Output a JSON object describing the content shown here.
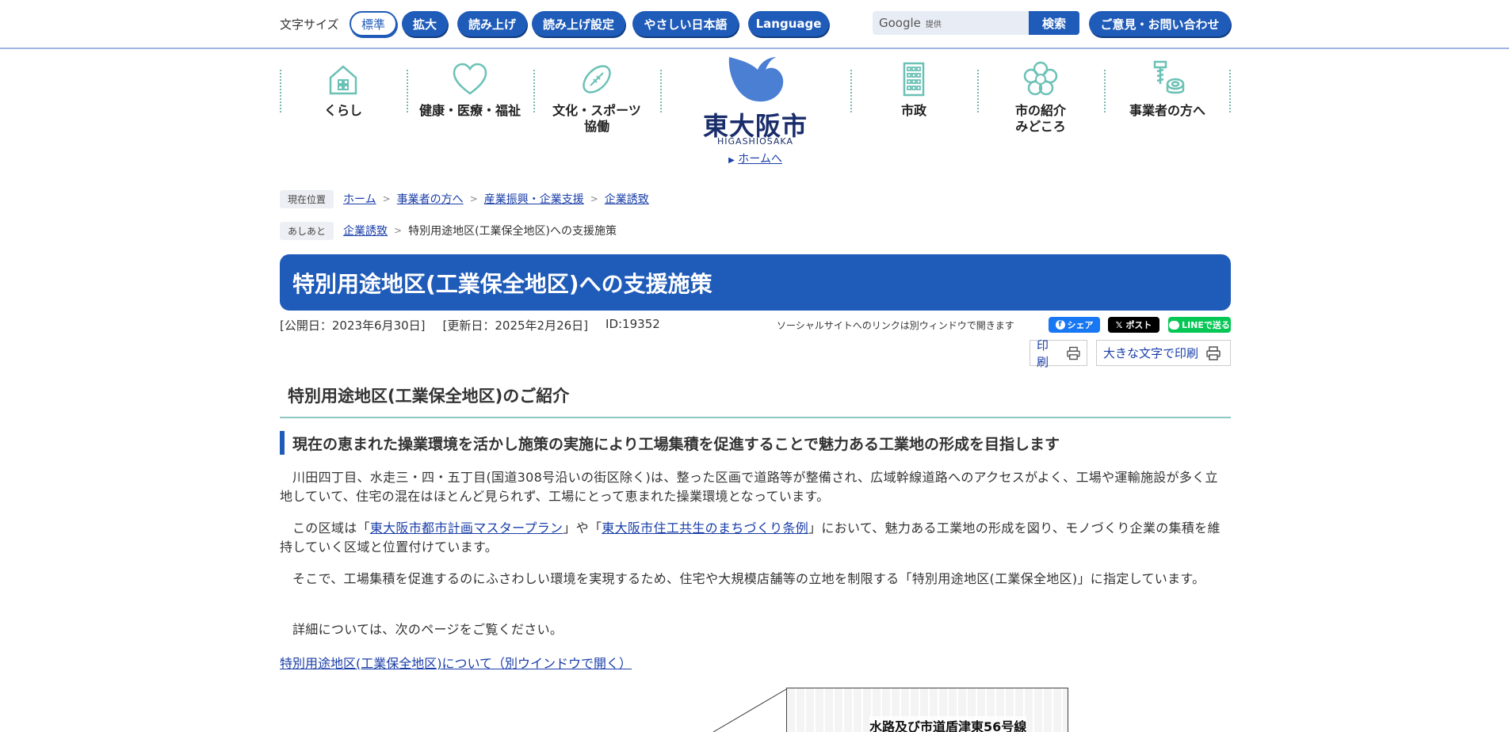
{
  "topbar": {
    "font_size_label": "文字サイズ",
    "btn_standard": "標準",
    "btn_large": "拡大",
    "btn_read": "読み上げ",
    "btn_read_settings": "読み上げ設定",
    "btn_easy_japanese": "やさしい日本語",
    "btn_language": "Language",
    "search_google": "Google",
    "search_provided": "提供",
    "search_button": "検索",
    "contact_button": "ご意見・お問い合わせ"
  },
  "nav": {
    "item_kurashi": "くらし",
    "item_health": "健康・医療・福祉",
    "item_culture_1": "文化・スポーツ",
    "item_culture_2": "協働",
    "item_shisei": "市政",
    "item_intro_1": "市の紹介",
    "item_intro_2": "みどころ",
    "item_business": "事業者の方へ"
  },
  "logo": {
    "kanji": "東大阪市",
    "roman": "HIGASHIOSAKA",
    "home_link": "ホームへ"
  },
  "breadcrumb": {
    "current_tag": "現在位置",
    "items": [
      "ホーム",
      "事業者の方へ",
      "産業振興・企業支援",
      "企業誘致"
    ],
    "history_tag": "あしあと",
    "history_link": "企業誘致",
    "history_current": "特別用途地区(工業保全地区)への支援施策"
  },
  "page": {
    "title": "特別用途地区(工業保全地区)への支援施策",
    "published": "[公開日：2023年6月30日]",
    "updated": "[更新日：2025年2月26日]",
    "id": "ID:19352",
    "social_note": "ソーシャルサイトへのリンクは別ウィンドウで開きます",
    "share_facebook": "シェア",
    "share_x": "ポスト",
    "share_line": "LINEで送る",
    "print": "印刷",
    "print_large": "大きな文字で印刷"
  },
  "content": {
    "h2": "特別用途地区(工業保全地区)のご紹介",
    "h3": "現在の恵まれた操業環境を活かし施策の実施により工場集積を促進することで魅力ある工業地の形成を目指します",
    "p1": "川田四丁目、水走三・四・五丁目(国道308号沿いの街区除く)は、整った区画で道路等が整備され、広域幹線道路へのアクセスがよく、工場や運輸施設が多く立地していて、住宅の混在はほとんど見られず、工場にとって恵まれた操業環境となっています。",
    "p2_a": "この区域は「",
    "p2_link1": "東大阪市都市計画マスタープラン",
    "p2_b": "」や「",
    "p2_link2": "東大阪市住工共生のまちづくり条例",
    "p2_c": "」において、魅力ある工業地の形成を図り、モノづくり企業の集積を維持していく区域と位置付けています。",
    "p3": "そこで、工場集積を促進するのにふさわしい環境を実現するため、住宅や大規模店舗等の立地を制限する「特別用途地区(工業保全地区)」に指定しています。",
    "p4": "詳細については、次のページをご覧ください。",
    "link": "特別用途地区(工業保全地区)について（別ウインドウで開く）",
    "map_label": "水路及び市道盾津東56号線"
  },
  "colors": {
    "brand_blue": "#1f5bb8",
    "accent_teal": "#8ec9c1",
    "link": "#1a3ea8"
  }
}
